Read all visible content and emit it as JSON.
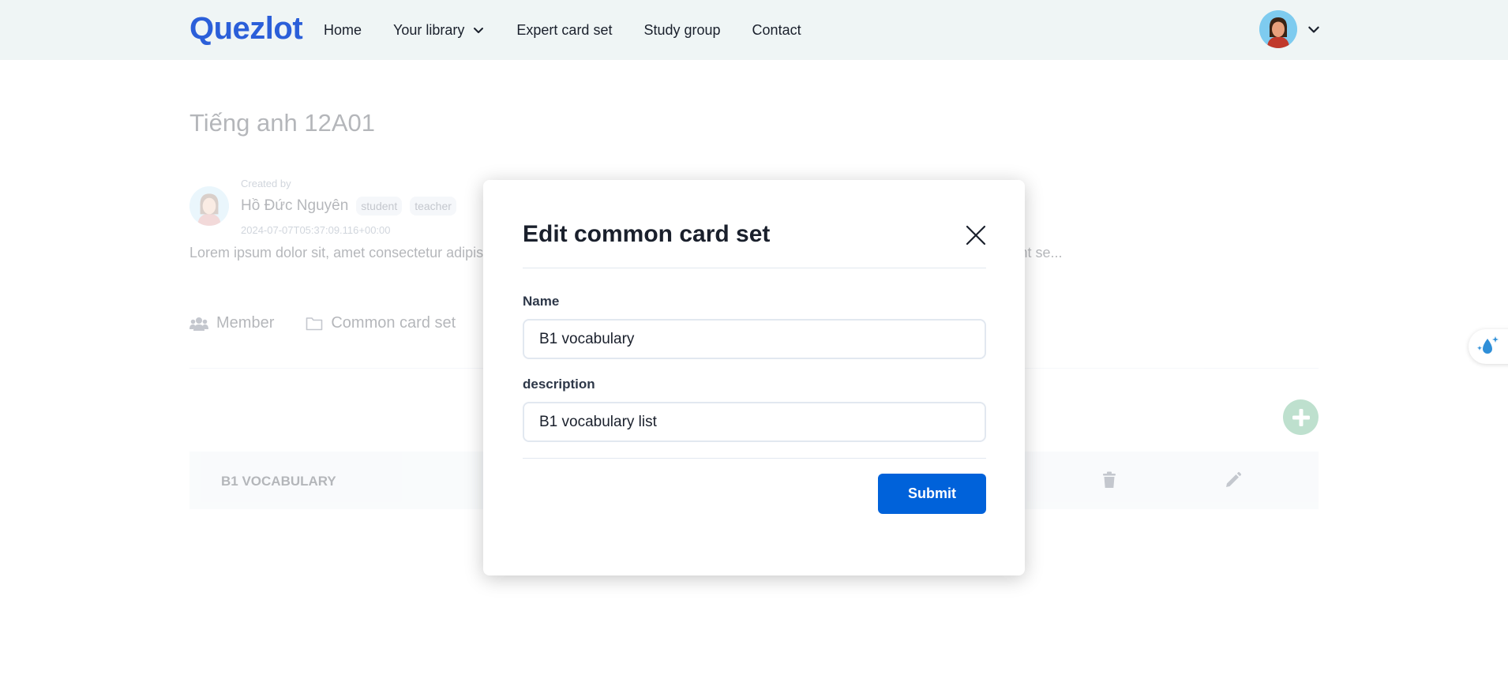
{
  "header": {
    "logo": "Quezlot",
    "nav": [
      {
        "label": "Home"
      },
      {
        "label": "Your library"
      },
      {
        "label": "Expert card set"
      },
      {
        "label": "Study group"
      },
      {
        "label": "Contact"
      }
    ]
  },
  "group": {
    "title": "Tiếng anh 12A01",
    "created_by_label": "Created by",
    "creator_name": "Hồ Đức Nguyên",
    "roles": [
      "student",
      "teacher"
    ],
    "created_at": "2024-07-07T05:37:09.116+00:00",
    "description": "Lorem ipsum dolor sit, amet consectetur adipisi... te consectetur quisquam cumque quod molestias atque eius ducimus possimus, sint se...",
    "tabs": [
      {
        "label": "Member",
        "icon": "users-icon"
      },
      {
        "label": "Common card set",
        "icon": "folder-icon"
      }
    ],
    "card_sets": [
      {
        "title": "B1 VOCABULARY"
      }
    ]
  },
  "modal": {
    "title": "Edit common card set",
    "name_label": "Name",
    "name_value": "B1 vocabulary",
    "description_label": "description",
    "description_value": "B1 vocabulary list",
    "submit_label": "Submit"
  },
  "colors": {
    "brand": "#2b5fd9",
    "primary_button": "#0062da",
    "add_button": "#38a169",
    "topbar_bg": "#eff5f5"
  }
}
